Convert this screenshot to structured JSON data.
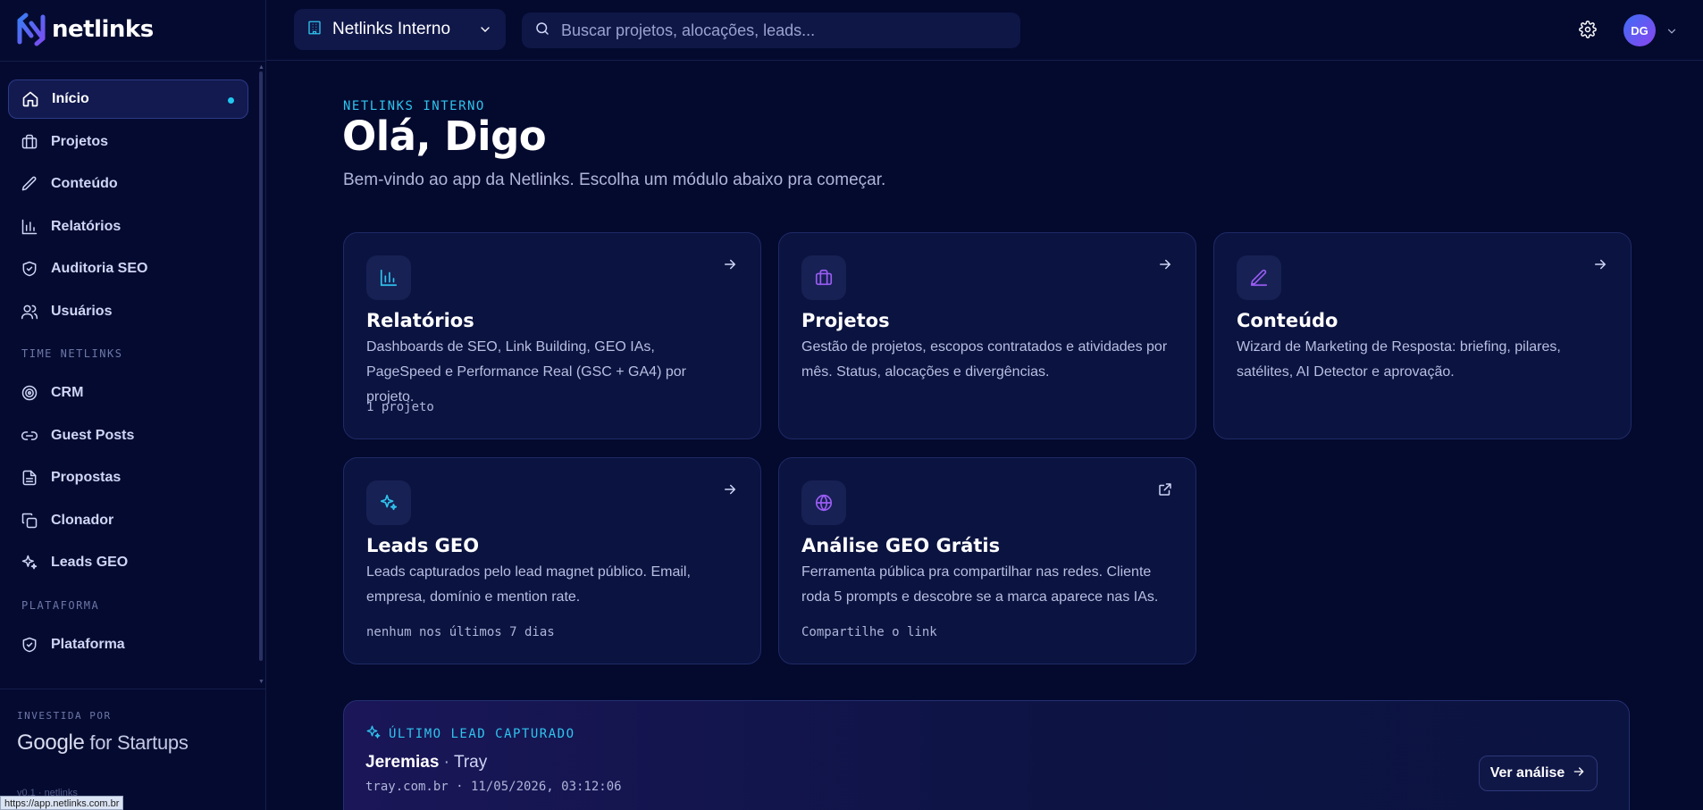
{
  "brand": {
    "name": "netlinks"
  },
  "sidebar": {
    "items": [
      {
        "label": "Início",
        "icon": "home-icon"
      },
      {
        "label": "Projetos",
        "icon": "briefcase-icon"
      },
      {
        "label": "Conteúdo",
        "icon": "pen-icon"
      },
      {
        "label": "Relatórios",
        "icon": "bar-chart-icon"
      },
      {
        "label": "Auditoria SEO",
        "icon": "shield-check-icon"
      },
      {
        "label": "Usuários",
        "icon": "users-icon"
      }
    ],
    "section_time": "TIME NETLINKS",
    "time_items": [
      {
        "label": "CRM",
        "icon": "target-icon"
      },
      {
        "label": "Guest Posts",
        "icon": "link-icon"
      },
      {
        "label": "Propostas",
        "icon": "file-icon"
      },
      {
        "label": "Clonador",
        "icon": "copy-icon"
      },
      {
        "label": "Leads GEO",
        "icon": "sparkles-icon"
      }
    ],
    "section_plataforma": "PLATAFORMA",
    "plataforma_items": [
      {
        "label": "Plataforma",
        "icon": "shield-check-icon"
      }
    ],
    "invested_by": "INVESTIDA POR",
    "google_part1": "Google",
    "google_part2": " for Startups",
    "version": "v0.1 · netlinks"
  },
  "status_url": "https://app.netlinks.com.br",
  "topbar": {
    "workspace": "Netlinks Interno",
    "search_placeholder": "Buscar projetos, alocações, leads...",
    "avatar_initials": "DG"
  },
  "main": {
    "eyebrow": "NETLINKS INTERNO",
    "greeting": "Olá, Digo",
    "subtitle": "Bem-vindo ao app da Netlinks. Escolha um módulo abaixo pra começar."
  },
  "cards": [
    {
      "title": "Relatórios",
      "desc": "Dashboards de SEO, Link Building, GEO IAs, PageSpeed e Performance Real (GSC + GA4) por projeto.",
      "meta": "1 projeto",
      "icon": "bar-chart-icon",
      "action": "arrow-right-icon"
    },
    {
      "title": "Projetos",
      "desc": "Gestão de projetos, escopos contratados e atividades por mês. Status, alocações e divergências.",
      "meta": "",
      "icon": "briefcase-icon",
      "action": "arrow-right-icon"
    },
    {
      "title": "Conteúdo",
      "desc": "Wizard de Marketing de Resposta: briefing, pilares, satélites, AI Detector e aprovação.",
      "meta": "",
      "icon": "pen-icon",
      "action": "arrow-right-icon"
    },
    {
      "title": "Leads GEO",
      "desc": "Leads capturados pelo lead magnet público. Email, empresa, domínio e mention rate.",
      "meta": "nenhum nos últimos 7 dias",
      "icon": "sparkles-icon",
      "action": "arrow-right-icon"
    },
    {
      "title": "Análise GEO Grátis",
      "desc": "Ferramenta pública pra compartilhar nas redes. Cliente roda 5 prompts e descobre se a marca aparece nas IAs.",
      "meta": "Compartilhe o link",
      "icon": "globe-icon",
      "action": "external-link-icon"
    }
  ],
  "last_lead": {
    "eyebrow": "ÚLTIMO LEAD CAPTURADO",
    "name": "Jeremias",
    "separator": " · ",
    "company": "Tray",
    "meta": "tray.com.br · 11/05/2026, 03:12:06",
    "button": "Ver análise"
  },
  "colors": {
    "background": "#040a2e",
    "accent_cyan": "#2fc4ee",
    "accent_purple": "#8a45f0",
    "card": "#0b1340"
  }
}
